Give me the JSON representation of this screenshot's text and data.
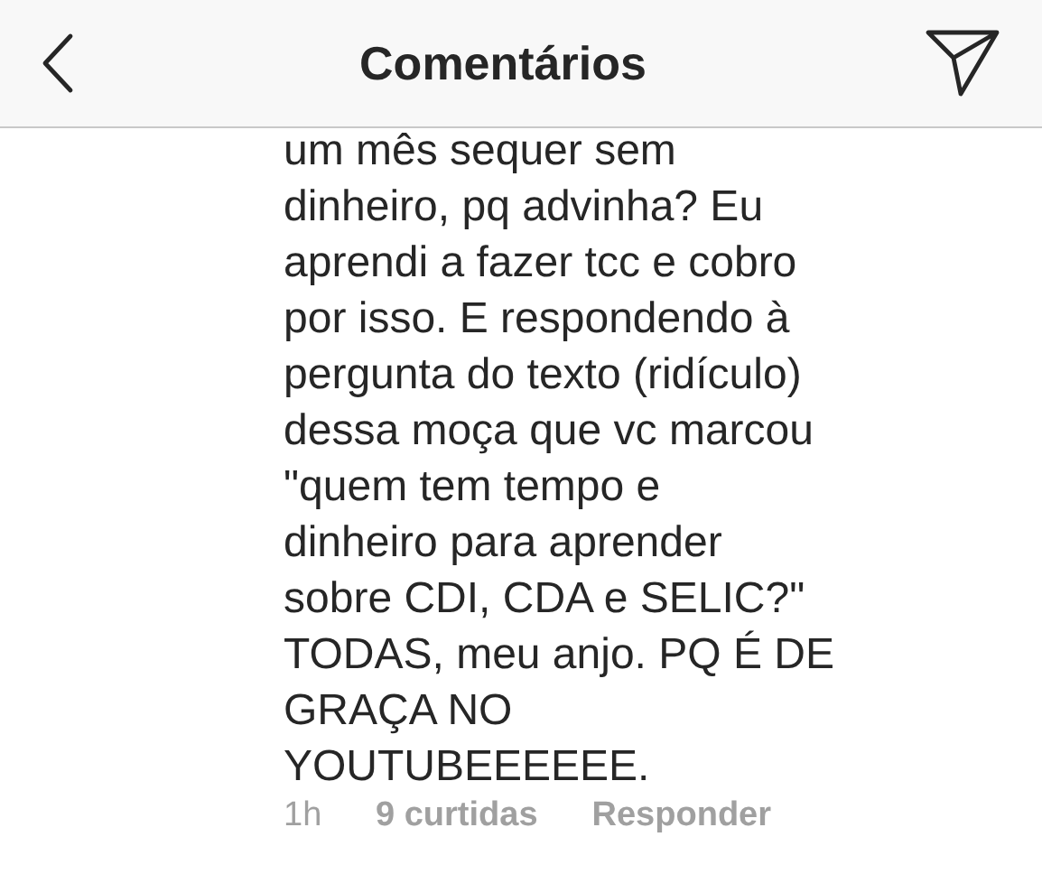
{
  "header": {
    "title": "Comentários"
  },
  "comment": {
    "text": "um mês sequer sem\ndinheiro, pq advinha? Eu\naprendi a fazer tcc e cobro\npor isso. E respondendo à\npergunta do texto (ridículo)\ndessa moça que vc marcou\n\"quem tem tempo e\ndinheiro para aprender\nsobre CDI, CDA e SELIC?\"\nTODAS, meu anjo. PQ É DE\nGRAÇA NO\nYOUTUBEEEEEE.",
    "time": "1h",
    "likes": "9 curtidas",
    "reply": "Responder"
  }
}
